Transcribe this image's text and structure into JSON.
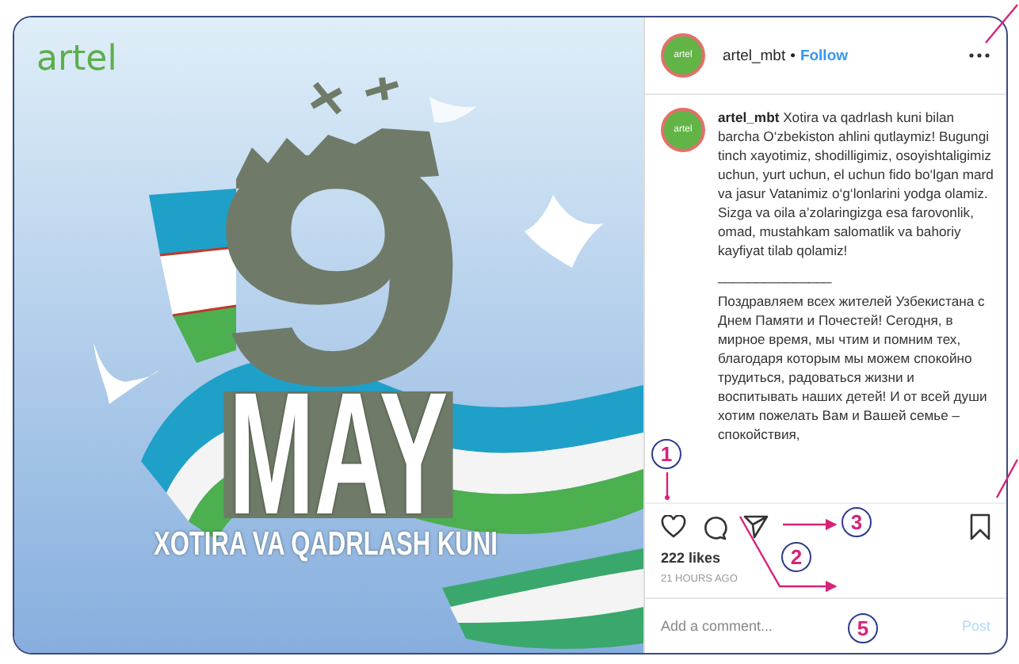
{
  "post_image": {
    "logo": "artel",
    "day": "9",
    "month": "MAY",
    "subtitle": "XOTIRA VA QADRLASH KUNI"
  },
  "header": {
    "avatar_label": "artel",
    "username": "artel_mbt",
    "separator": "•",
    "follow": "Follow"
  },
  "caption": {
    "avatar_label": "artel",
    "username": "artel_mbt",
    "paragraphs": [
      "Xotira va qadrlash kuni bilan barcha O‘zbekiston ahlini qutlaymiz! Bugungi tinch xayotimiz, shodilligimiz, osoyishtaligimiz uchun, yurt uchun, el uchun fido bo‘lgan mard va jasur Vatanimiz o‘g‘lonlarini yodga olamiz. Sizga va oila a’zolaringizga esa farovonlik, omad, mustahkam salomatlik va bahoriy kayfiyat tilab qolamiz!",
      "_______________",
      "Поздравляем всех жителей Узбекистана с Днем Памяти и Почестей! Сегодня, в мирное время, мы чтим и помним тех, благодаря которым мы можем спокойно трудиться, радоваться жизни и воспитывать наших детей! И от всей души хотим пожелать Вам и Вашей семье – спокойствия,"
    ]
  },
  "likes": "222 likes",
  "time": "21 HOURS AGO",
  "comment": {
    "placeholder": "Add a comment...",
    "post": "Post"
  },
  "annotations": [
    {
      "label": "1"
    },
    {
      "label": "2"
    },
    {
      "label": "3"
    },
    {
      "label": "5"
    }
  ]
}
